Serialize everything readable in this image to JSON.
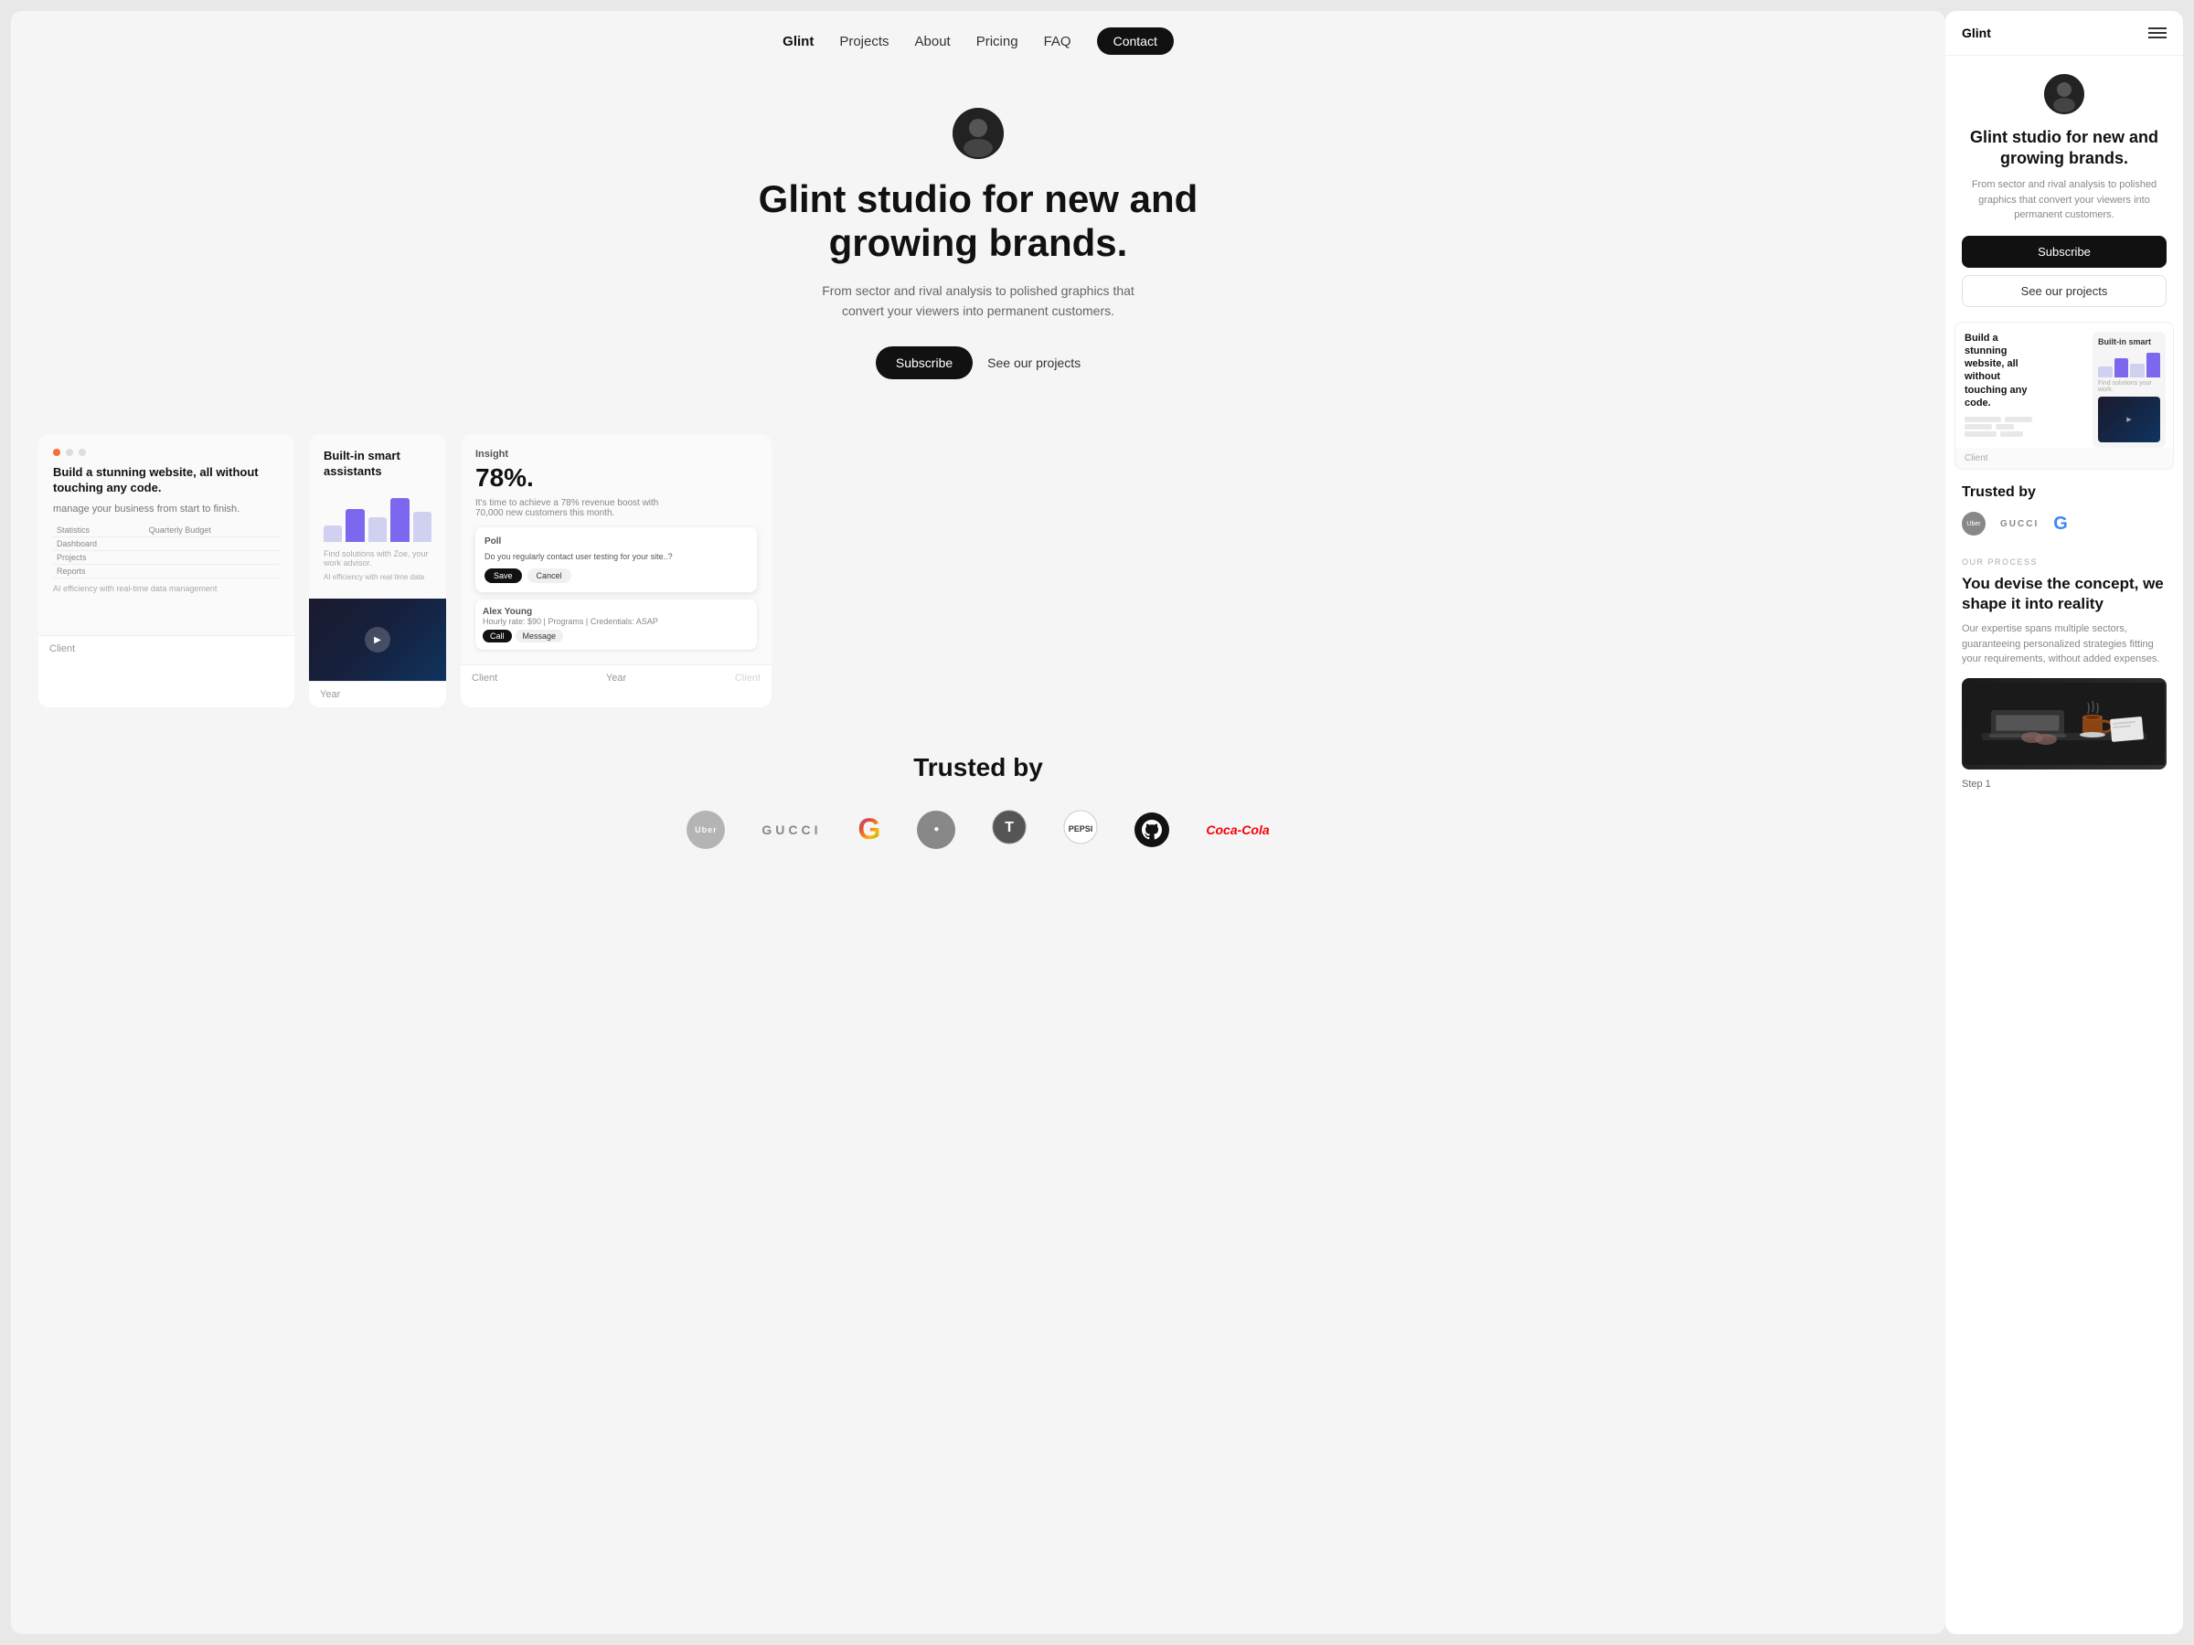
{
  "nav": {
    "brand": "Glint",
    "links": [
      "Projects",
      "About",
      "Pricing",
      "FAQ"
    ],
    "contact_label": "Contact"
  },
  "hero": {
    "title": "Glint studio for new and growing brands.",
    "subtitle": "From sector and rival analysis to polished graphics that convert your viewers into permanent customers.",
    "btn_subscribe": "Subscribe",
    "btn_projects": "See our projects"
  },
  "projects_strip": {
    "cards": [
      {
        "title": "Build a stunning website, all without touching any code.",
        "subtitle": "manage your business from start to finish.",
        "tag": "orange",
        "client": "Client",
        "year": ""
      },
      {
        "title": "Built-in smart assistants",
        "subtitle": "Find solutions with Zoe, your work advisor.",
        "has_chart": true,
        "has_video": true,
        "client": "Year"
      },
      {
        "title": "Insight",
        "percent": "78%.",
        "desc": "It's time to achieve a 78% revenue boost with 70,000 new customers this month.",
        "client": "Client",
        "year": "Year"
      }
    ]
  },
  "trusted": {
    "title": "Trusted by",
    "logos": [
      "Uber",
      "GUCCI",
      "G",
      "●",
      "Tesla",
      "Pepsi",
      "GitHub",
      "Coca-Cola"
    ]
  },
  "mobile": {
    "brand": "Glint",
    "hero_title": "Glint studio for new and growing brands.",
    "hero_desc": "From sector and rival analysis to polished graphics that convert your viewers into permanent customers.",
    "btn_subscribe": "Subscribe",
    "btn_projects": "See our projects",
    "preview_title": "Build a stunning website, all without touching any code.",
    "preview_side_title": "Built-in smart",
    "preview_caption": "Client",
    "trusted_title": "Trusted by",
    "process_label": "OUR PROCESS",
    "process_title": "You devise the concept, we shape it into reality",
    "process_desc": "Our expertise spans multiple sectors, guaranteeing personalized strategies fitting your requirements, without added expenses.",
    "step_label": "Step 1"
  },
  "colors": {
    "primary": "#111111",
    "bg_main": "#f5f5f5",
    "bg_right": "#ffffff",
    "accent": "#ff6b35"
  }
}
